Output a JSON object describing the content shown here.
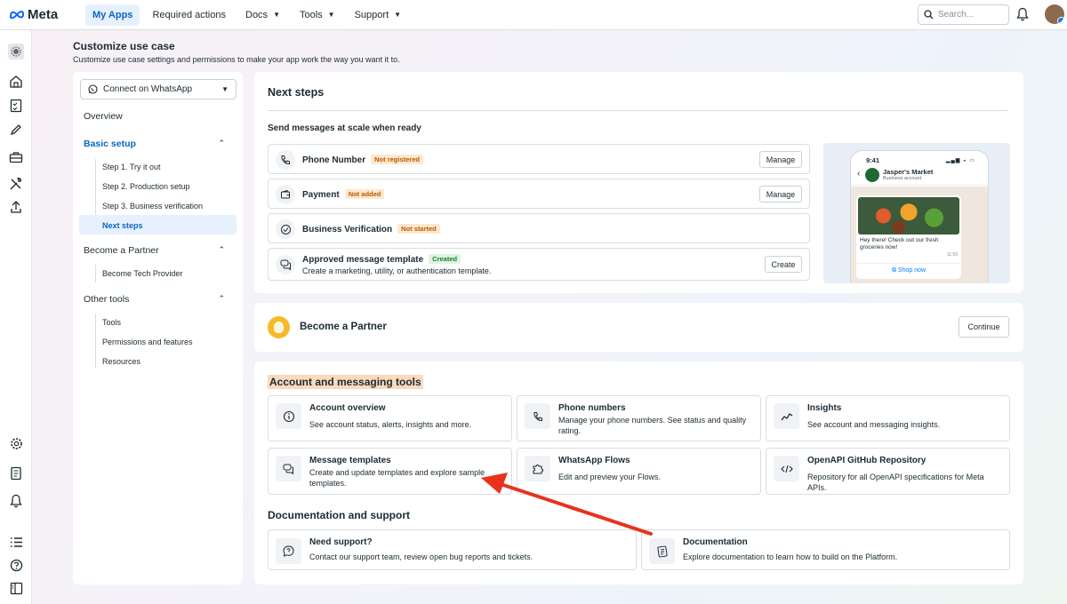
{
  "topbar": {
    "logo": "Meta",
    "nav": [
      {
        "label": "My Apps"
      },
      {
        "label": "Required actions"
      },
      {
        "label": "Docs",
        "dropdown": true
      },
      {
        "label": "Tools",
        "dropdown": true
      },
      {
        "label": "Support",
        "dropdown": true
      }
    ],
    "search_placeholder": "Search..."
  },
  "page": {
    "title": "Customize use case",
    "subtitle": "Customize use case settings and permissions to make your app work the way you want it to."
  },
  "sidenav": {
    "use_case": "Connect on WhatsApp",
    "overview": "Overview",
    "basic_setup": "Basic setup",
    "basic_steps": [
      "Step 1. Try it out",
      "Step 2. Production setup",
      "Step 3. Business verification",
      "Next steps"
    ],
    "become_partner": "Become a Partner",
    "partner_items": [
      "Become Tech Provider"
    ],
    "other_tools": "Other tools",
    "other_items": [
      "Tools",
      "Permissions and features",
      "Resources"
    ]
  },
  "next_steps": {
    "title": "Next steps",
    "send_title": "Send messages at scale when ready",
    "rows": [
      {
        "title": "Phone Number",
        "badge": "Not registered",
        "action": "Manage",
        "icon": "phone-icon"
      },
      {
        "title": "Payment",
        "badge": "Not added",
        "action": "Manage",
        "icon": "wallet-icon"
      },
      {
        "title": "Business Verification",
        "badge": "Not started",
        "action": "",
        "icon": "check-circle-icon"
      },
      {
        "title": "Approved message template",
        "badge": "Created",
        "subtitle": "Create a marketing, utility, or authentication template.",
        "action": "Create",
        "icon": "chat-bubbles-icon"
      }
    ],
    "phone_preview": {
      "time": "9:41",
      "business_name": "Jasper's Market",
      "business_sub": "Business account",
      "message": "Hey there! Check out our fresh groceries now!",
      "msg_time": "11:59",
      "button": "Shop now"
    }
  },
  "partner_card": {
    "title": "Become a Partner",
    "button": "Continue"
  },
  "tools": {
    "title": "Account and messaging tools",
    "tiles": [
      {
        "title": "Account overview",
        "desc": "See account status, alerts, insights and more.",
        "icon": "info-icon"
      },
      {
        "title": "Phone numbers",
        "desc": "Manage your phone numbers. See status and quality rating.",
        "icon": "phone-icon"
      },
      {
        "title": "Insights",
        "desc": "See account and messaging insights.",
        "icon": "trend-icon"
      },
      {
        "title": "Message templates",
        "desc": "Create and update templates and explore sample templates.",
        "icon": "chat-bubbles-icon"
      },
      {
        "title": "WhatsApp Flows",
        "desc": "Edit and preview your Flows.",
        "icon": "puzzle-icon"
      },
      {
        "title": "OpenAPI GitHub Repository",
        "desc": "Repository for all OpenAPI specifications for Meta APIs.",
        "icon": "code-icon"
      }
    ],
    "doc_title": "Documentation and support",
    "doc_tiles": [
      {
        "title": "Need support?",
        "desc": "Contact our support team, review open bug reports and tickets.",
        "icon": "question-bubble-icon"
      },
      {
        "title": "Documentation",
        "desc": "Explore documentation to learn how to build on the Platform.",
        "icon": "document-icon"
      }
    ]
  },
  "colors": {
    "accent": "#0a66c2",
    "highlight": "#fbd9bd",
    "annotation_arrow": "#e8321e"
  }
}
